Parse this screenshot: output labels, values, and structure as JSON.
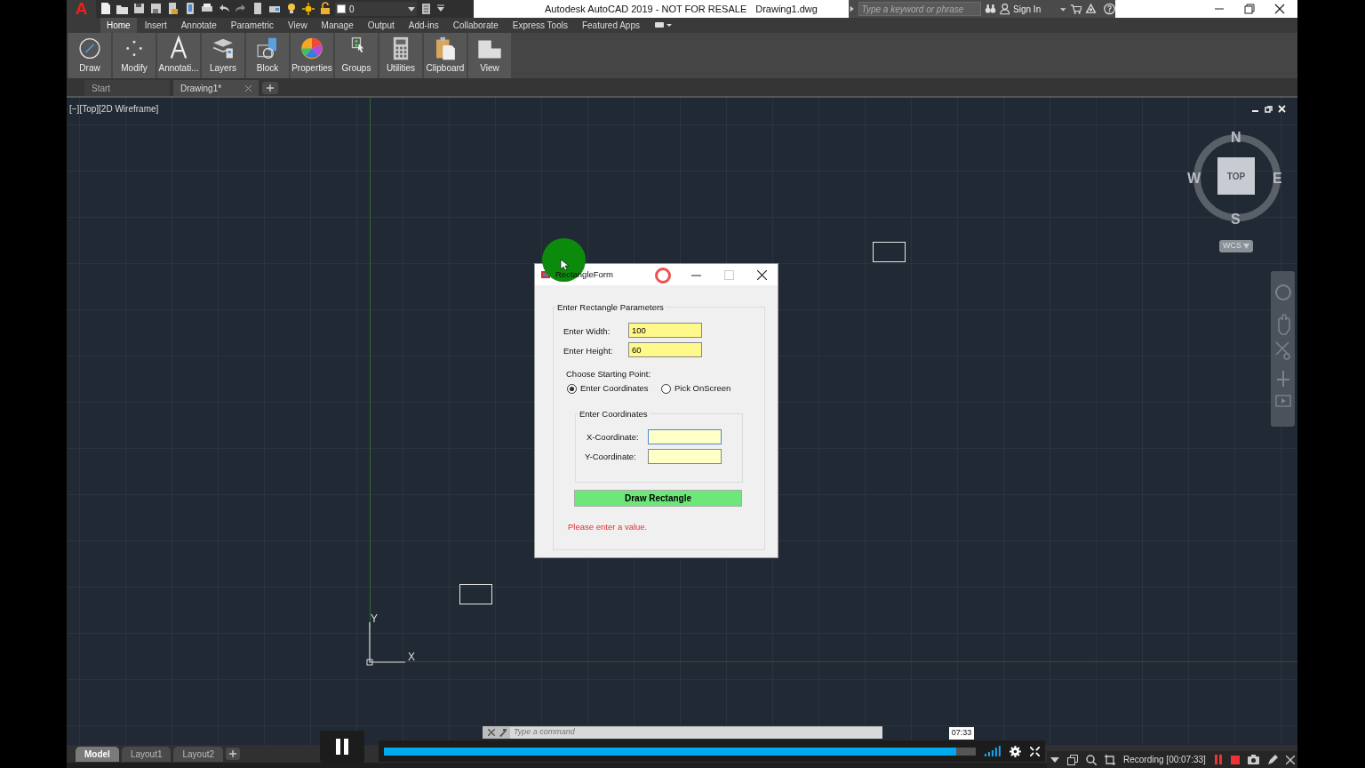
{
  "app": {
    "logo": "A",
    "product": "Autodesk AutoCAD 2019 - NOT FOR RESALE",
    "file": "Drawing1.dwg",
    "layer": "0"
  },
  "search": {
    "placeholder": "Type a keyword or phrase"
  },
  "sign_in": "Sign In",
  "ribbon_tabs": [
    {
      "label": "Home",
      "selected": true
    },
    {
      "label": "Insert",
      "selected": false
    },
    {
      "label": "Annotate",
      "selected": false
    },
    {
      "label": "Parametric",
      "selected": false
    },
    {
      "label": "View",
      "selected": false
    },
    {
      "label": "Manage",
      "selected": false
    },
    {
      "label": "Output",
      "selected": false
    },
    {
      "label": "Add-ins",
      "selected": false
    },
    {
      "label": "Collaborate",
      "selected": false
    },
    {
      "label": "Express Tools",
      "selected": false
    },
    {
      "label": "Featured Apps",
      "selected": false
    }
  ],
  "ribbon_panels": [
    {
      "label": "Draw"
    },
    {
      "label": "Modify"
    },
    {
      "label": "Annotati..."
    },
    {
      "label": "Layers"
    },
    {
      "label": "Block"
    },
    {
      "label": "Properties"
    },
    {
      "label": "Groups"
    },
    {
      "label": "Utilities"
    },
    {
      "label": "Clipboard"
    },
    {
      "label": "View"
    }
  ],
  "file_tabs": [
    {
      "label": "Start",
      "selected": false
    },
    {
      "label": "Drawing1*",
      "selected": true
    }
  ],
  "viewport_label": "[−][Top][2D Wireframe]",
  "viewcube": {
    "north": "N",
    "east": "E",
    "south": "S",
    "west": "W",
    "face": "TOP",
    "ucs": "WCS"
  },
  "ucs_icon": {
    "x": "X",
    "y": "Y"
  },
  "dialog": {
    "title": "RectangleForm",
    "group": "Enter Rectangle Parameters",
    "size_fields": [
      {
        "label": "Enter Width:",
        "value": "100"
      },
      {
        "label": "Enter Height:",
        "value": "60"
      }
    ],
    "start_label": "Choose Starting Point:",
    "radios": [
      {
        "label": "Enter Coordinates",
        "selected": true
      },
      {
        "label": "Pick OnScreen",
        "selected": false
      }
    ],
    "coord_group": "Enter Coordinates",
    "coord_fields": [
      {
        "label": "X-Coordinate:",
        "focused": true
      },
      {
        "label": "Y-Coordinate:",
        "focused": false
      }
    ],
    "button": "Draw Rectangle",
    "error": "Please enter a value."
  },
  "command_line": {
    "placeholder": "Type a command"
  },
  "layout_tabs": [
    {
      "label": "Model",
      "selected": true
    },
    {
      "label": "Layout1",
      "selected": false
    },
    {
      "label": "Layout2",
      "selected": false
    }
  ],
  "player": {
    "level": 0.967,
    "time": "07:33"
  },
  "recorder": {
    "label": "Recording [00:07:33]"
  }
}
